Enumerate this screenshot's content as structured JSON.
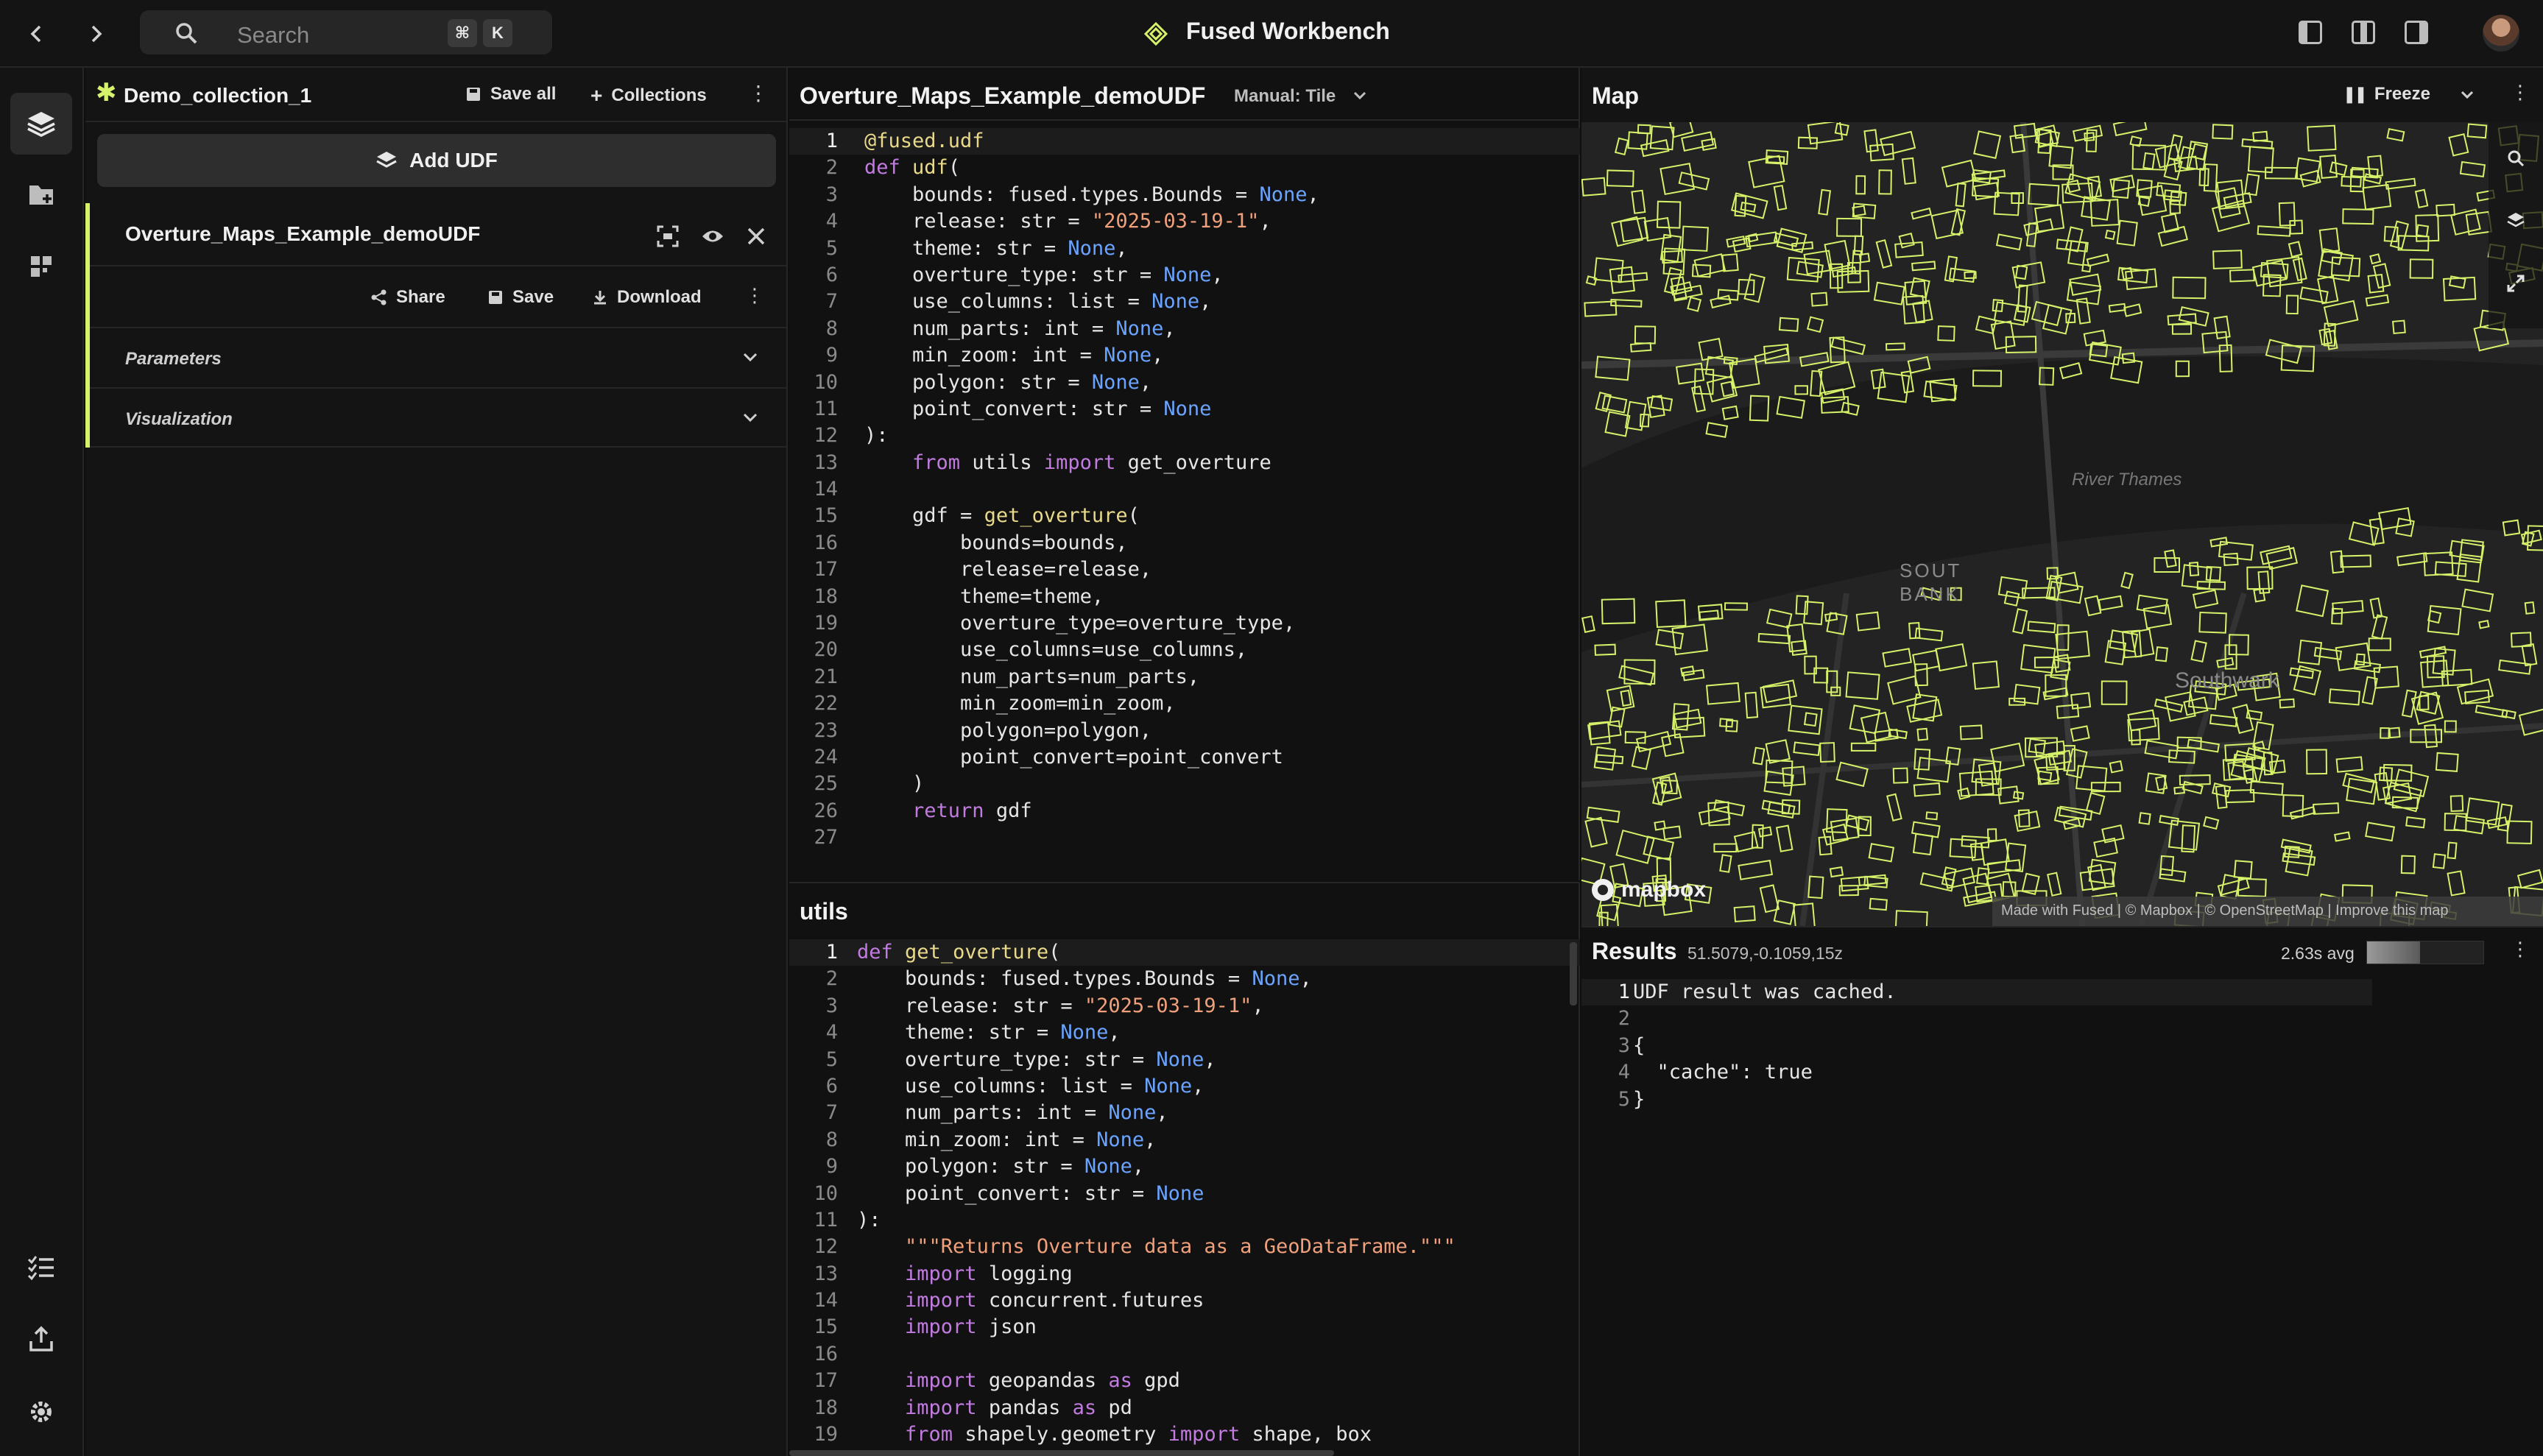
{
  "topbar": {
    "search_placeholder": "Search",
    "shortcut_mod": "⌘",
    "shortcut_key": "K",
    "title": "Fused Workbench"
  },
  "collection": {
    "name": "Demo_collection_1",
    "save_all": "Save all",
    "collections": "Collections",
    "add_udf": "Add UDF",
    "udf_name": "Overture_Maps_Example_demoUDF",
    "share": "Share",
    "save": "Save",
    "download": "Download",
    "parameters": "Parameters",
    "visualization": "Visualization"
  },
  "editor": {
    "title": "Overture_Maps_Example_demoUDF",
    "mode": "Manual: Tile",
    "lines": [
      "@fused.udf",
      "def udf(",
      "    bounds: fused.types.Bounds = None,",
      "    release: str = \"2025-03-19-1\",",
      "    theme: str = None,",
      "    overture_type: str = None,",
      "    use_columns: list = None,",
      "    num_parts: int = None,",
      "    min_zoom: int = None,",
      "    polygon: str = None,",
      "    point_convert: str = None",
      "):",
      "    from utils import get_overture",
      "",
      "    gdf = get_overture(",
      "        bounds=bounds,",
      "        release=release,",
      "        theme=theme,",
      "        overture_type=overture_type,",
      "        use_columns=use_columns,",
      "        num_parts=num_parts,",
      "        min_zoom=min_zoom,",
      "        polygon=polygon,",
      "        point_convert=point_convert",
      "    )",
      "    return gdf",
      ""
    ]
  },
  "utils": {
    "title": "utils",
    "lines": [
      "def get_overture(",
      "    bounds: fused.types.Bounds = None,",
      "    release: str = \"2025-03-19-1\",",
      "    theme: str = None,",
      "    overture_type: str = None,",
      "    use_columns: list = None,",
      "    num_parts: int = None,",
      "    min_zoom: int = None,",
      "    polygon: str = None,",
      "    point_convert: str = None",
      "):",
      "    \"\"\"Returns Overture data as a GeoDataFrame.\"\"\"",
      "    import logging",
      "    import concurrent.futures",
      "    import json",
      "",
      "    import geopandas as gpd",
      "    import pandas as pd",
      "    from shapely.geometry import shape, box"
    ]
  },
  "map": {
    "title": "Map",
    "freeze": "Freeze",
    "label_river": "River Thames",
    "label_south": "SOUT",
    "label_bank": "BANK",
    "label_southwark": "Southwark",
    "logo": "mapbox",
    "attribution": "Made with Fused | © Mapbox | © OpenStreetMap | Improve this map"
  },
  "results": {
    "title": "Results",
    "coords": "51.5079,-0.1059,15z",
    "timing": "2.63s avg",
    "lines": [
      "UDF result was cached.",
      "",
      "{",
      "  \"cache\": true",
      "}"
    ]
  },
  "colors": {
    "accent": "#d6f26a",
    "keyword": "#c27be0",
    "number_none": "#6aa4ff",
    "string": "#f0a07a",
    "function": "#e9d98a"
  }
}
